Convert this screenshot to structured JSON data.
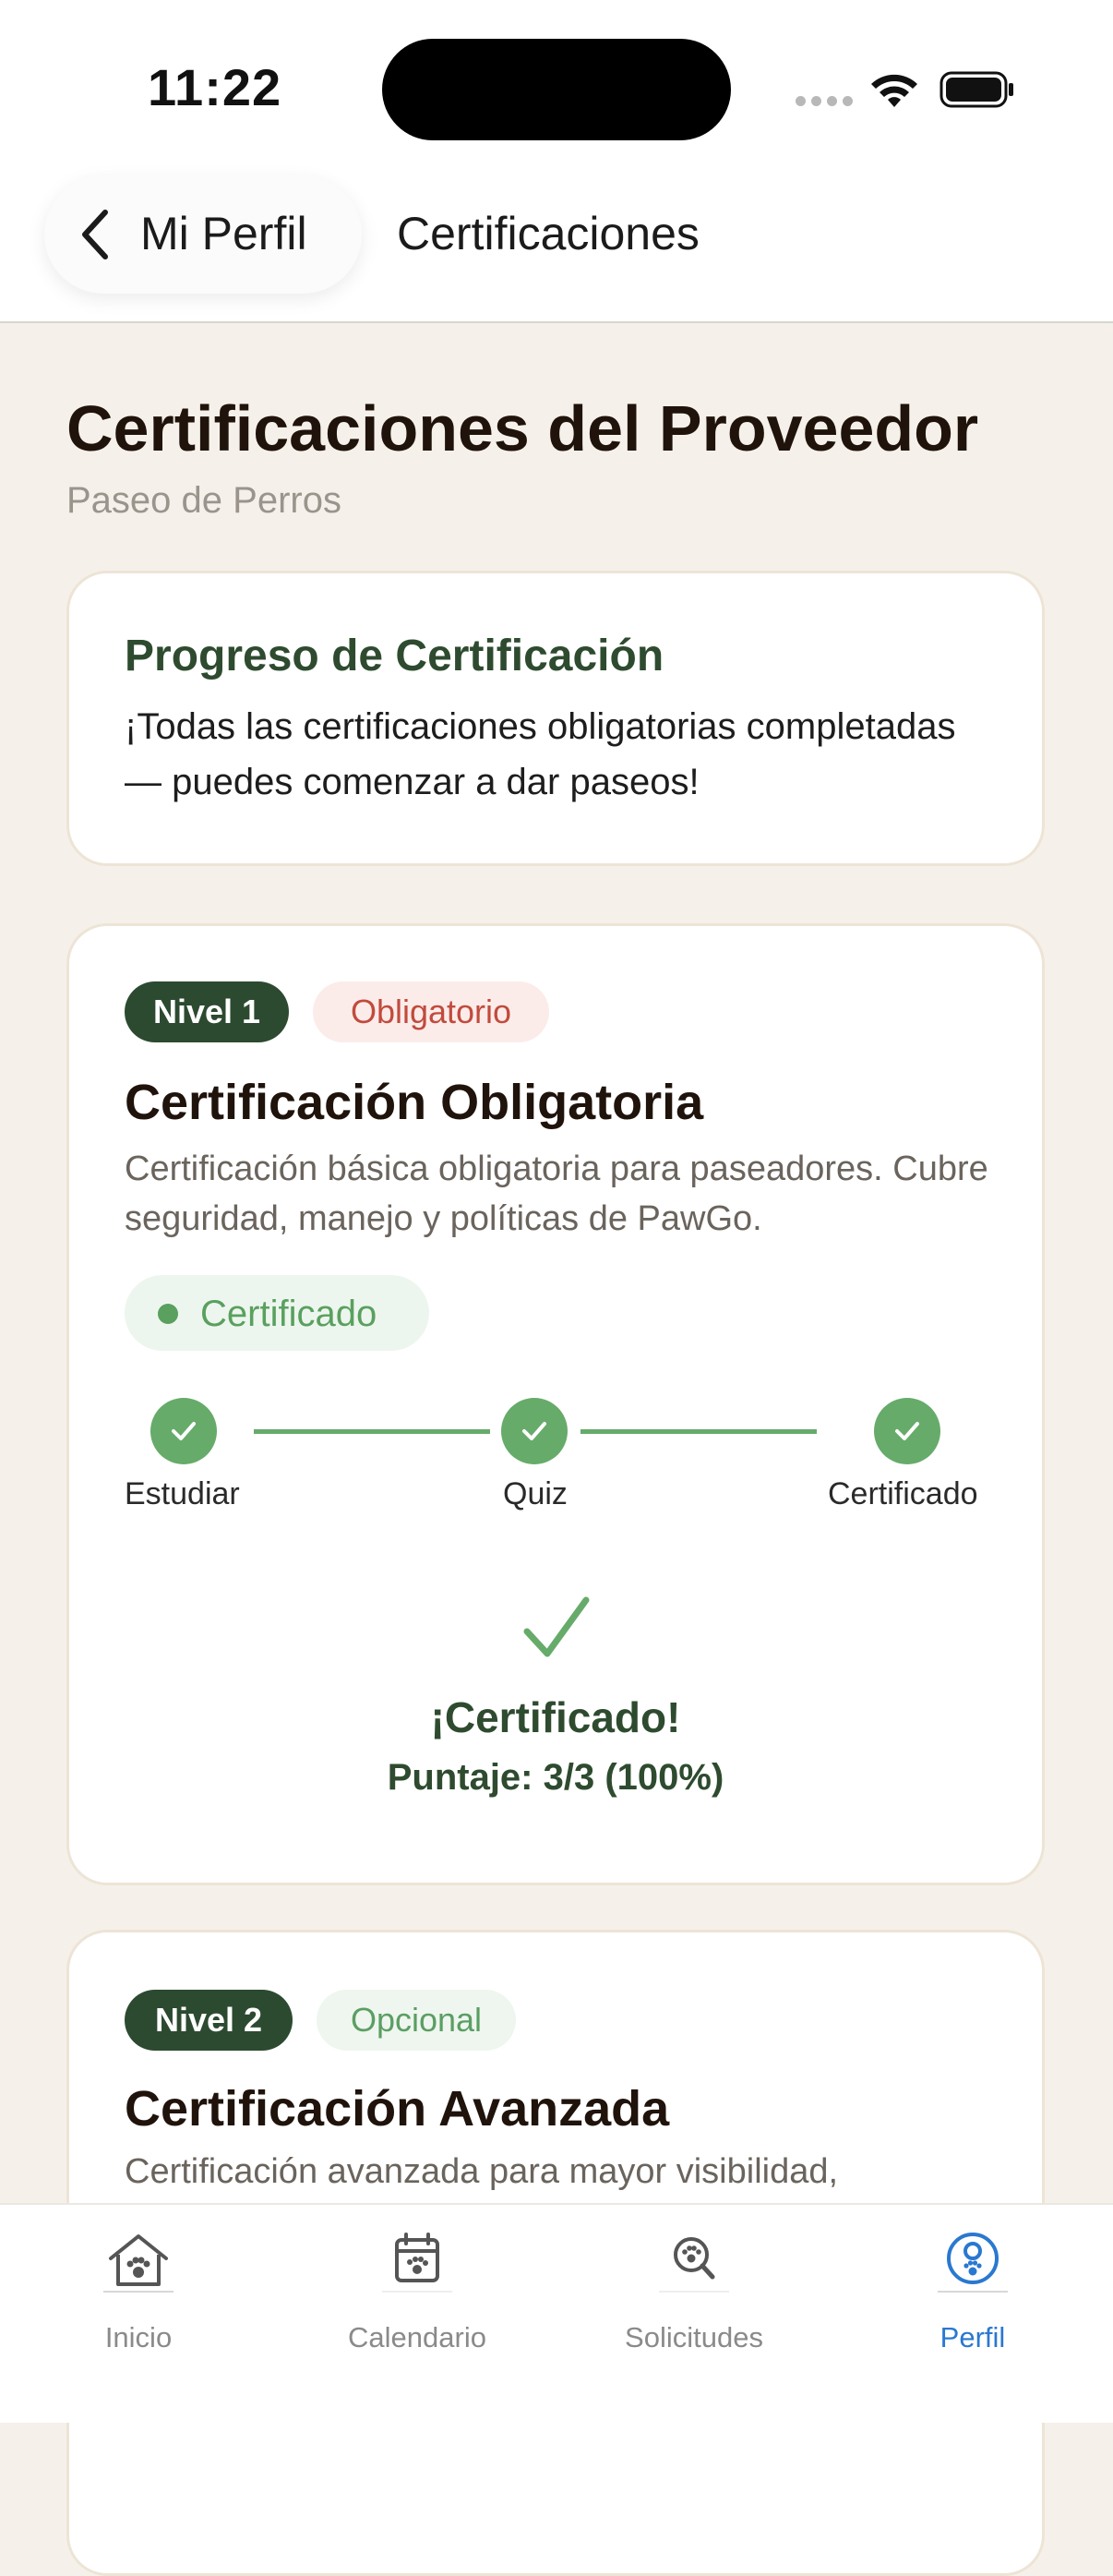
{
  "status_bar": {
    "time": "11:22"
  },
  "nav": {
    "back_label": "Mi Perfil",
    "title": "Certificaciones"
  },
  "page": {
    "title": "Certificaciones del Proveedor",
    "subtitle": "Paseo de Perros"
  },
  "progress": {
    "title": "Progreso de Certificación",
    "text": "¡Todas las certificaciones obligatorias completadas — puedes comenzar a dar paseos!"
  },
  "certifications": [
    {
      "level": "Nivel 1",
      "tag": "Obligatorio",
      "title": "Certificación Obligatoria",
      "description": "Certificación básica obligatoria para paseadores. Cubre seguridad, manejo y políticas de PawGo.",
      "status": "Certificado",
      "steps": [
        "Estudiar",
        "Quiz",
        "Certificado"
      ],
      "result_title": "¡Certificado!",
      "result_score": "Puntaje: 3/3 (100%)"
    },
    {
      "level": "Nivel 2",
      "tag": "Opcional",
      "title": "Certificación Avanzada",
      "description": "Certificación avanzada para mayor visibilidad,"
    }
  ],
  "tabs": [
    {
      "label": "Inicio",
      "icon": "home-paw-icon"
    },
    {
      "label": "Calendario",
      "icon": "calendar-paw-icon"
    },
    {
      "label": "Solicitudes",
      "icon": "search-paw-icon"
    },
    {
      "label": "Perfil",
      "icon": "profile-paw-icon",
      "active": true
    }
  ],
  "colors": {
    "background": "#f5f1ea",
    "primary_green": "#2c4a30",
    "success_green": "#66ab6a",
    "required_red": "#c14b3c",
    "active_tab": "#2a78d0"
  }
}
